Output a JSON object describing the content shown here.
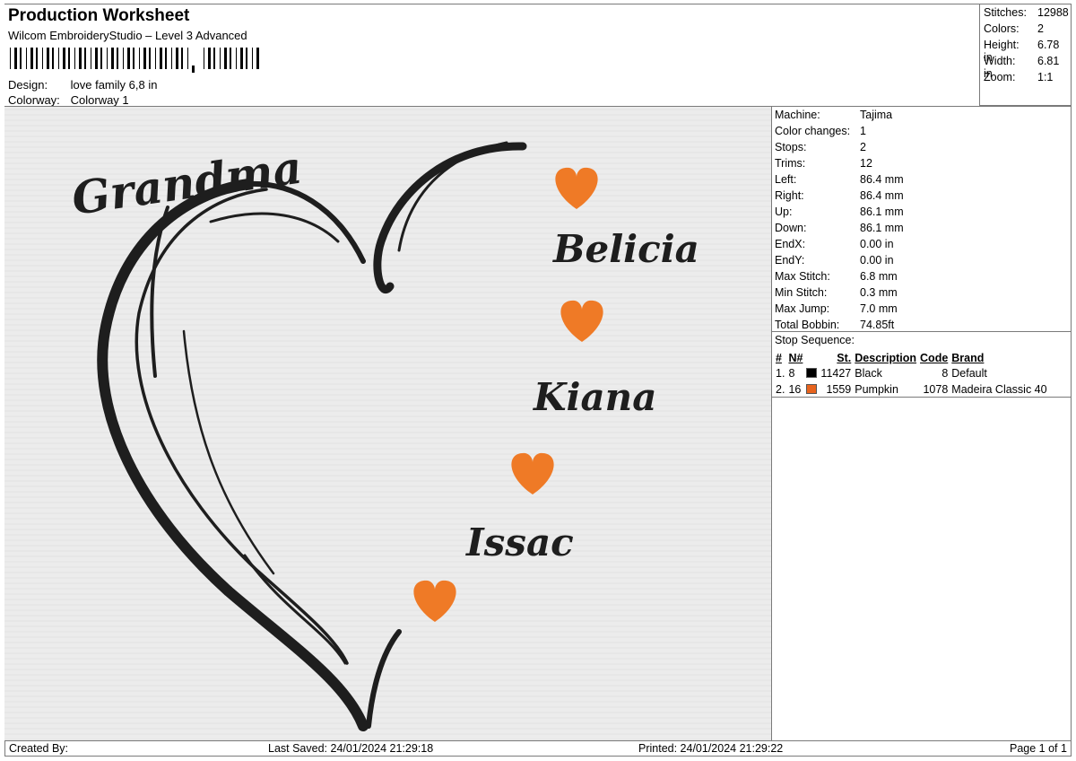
{
  "header": {
    "title": "Production Worksheet",
    "subtitle": "Wilcom EmbroideryStudio – Level 3 Advanced",
    "design_label": "Design:",
    "design_value": "love family 6,8 in",
    "colorway_label": "Colorway:",
    "colorway_value": "Colorway 1"
  },
  "stats": [
    {
      "label": "Stitches:",
      "value": "12988"
    },
    {
      "label": "Colors:",
      "value": "2"
    },
    {
      "label": "Height:",
      "value": "6.78 in"
    },
    {
      "label": "Width:",
      "value": "6.81 in"
    },
    {
      "label": "Zoom:",
      "value": "1:1"
    }
  ],
  "machine_info": [
    {
      "label": "Machine:",
      "value": "Tajima"
    },
    {
      "label": "Color changes:",
      "value": "1"
    },
    {
      "label": "Stops:",
      "value": "2"
    },
    {
      "label": "Trims:",
      "value": "12"
    },
    {
      "label": "Left:",
      "value": "86.4 mm"
    },
    {
      "label": "Right:",
      "value": "86.4 mm"
    },
    {
      "label": "Up:",
      "value": "86.1 mm"
    },
    {
      "label": "Down:",
      "value": "86.1 mm"
    },
    {
      "label": "EndX:",
      "value": "0.00 in"
    },
    {
      "label": "EndY:",
      "value": "0.00 in"
    },
    {
      "label": "Max Stitch:",
      "value": "6.8 mm"
    },
    {
      "label": "Min Stitch:",
      "value": "0.3 mm"
    },
    {
      "label": "Max Jump:",
      "value": "7.0 mm"
    },
    {
      "label": "Total Bobbin:",
      "value": "74.85ft"
    }
  ],
  "stop_sequence": {
    "title": "Stop Sequence:",
    "columns": [
      "#",
      "N#",
      "St.",
      "Description",
      "Code",
      "Brand"
    ],
    "rows": [
      {
        "idx": "1.",
        "n": "8",
        "color": "#000000",
        "stitches": "11427",
        "description": "Black",
        "code": "8",
        "brand": "Default"
      },
      {
        "idx": "2.",
        "n": "16",
        "color": "#e8641e",
        "stitches": "1559",
        "description": "Pumpkin",
        "code": "1078",
        "brand": "Madeira Classic 40"
      }
    ]
  },
  "design": {
    "thread_black": "#1e1e1e",
    "thread_orange": "#ef7a26",
    "background": "#ececec",
    "texts": {
      "grandma": "Grandma",
      "name1": "Belicia",
      "name2": "Kiana",
      "name3": "Issac"
    }
  },
  "footer": {
    "created_by": "Created By:",
    "last_saved": "Last Saved: 24/01/2024 21:29:18",
    "printed": "Printed: 24/01/2024 21:29:22",
    "page": "Page 1 of 1"
  }
}
